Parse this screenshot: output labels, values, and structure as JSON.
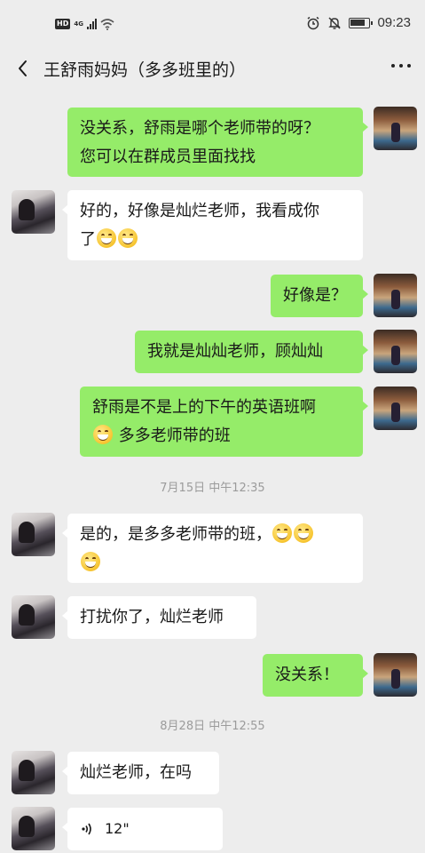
{
  "status_bar": {
    "hd": "HD",
    "network": "4G",
    "time": "09:23",
    "icons": [
      "signal-icon",
      "wifi-icon",
      "alarm-icon",
      "mute-icon",
      "battery-icon"
    ]
  },
  "header": {
    "title": "王舒雨妈妈（多多班里的）",
    "back_icon": "chevron-left-icon",
    "more_icon": "ellipsis-icon"
  },
  "messages": [
    {
      "side": "me",
      "lines": [
        "没关系，舒雨是哪个老师带的呀？",
        "您可以在群成员里面找找"
      ]
    },
    {
      "side": "them",
      "lines": [
        "好的，好像是灿烂老师，我看成你",
        "了"
      ],
      "emoji_count": 2
    },
    {
      "side": "me",
      "lines": [
        "好像是？"
      ]
    },
    {
      "side": "me",
      "lines": [
        "我就是灿灿老师，顾灿灿"
      ]
    },
    {
      "side": "me",
      "lines": [
        "舒雨是不是上的下午的英语班啊",
        "多多老师带的班"
      ],
      "emoji_count": 1
    },
    {
      "side": "them",
      "lines": [
        "是的，是多多老师带的班，"
      ],
      "emoji_count": 3
    },
    {
      "side": "them",
      "lines": [
        "打扰你了，灿烂老师"
      ]
    },
    {
      "side": "me",
      "lines": [
        "没关系！"
      ]
    },
    {
      "side": "them",
      "lines": [
        "灿烂老师，在吗"
      ]
    },
    {
      "side": "them",
      "type": "voice",
      "duration": "12\""
    }
  ],
  "timestamps": [
    "7月15日 中午12:35",
    "8月28日 中午12:55"
  ],
  "colors": {
    "bubble_me": "#95ec69",
    "bubble_them": "#ffffff",
    "background": "#ededed"
  }
}
